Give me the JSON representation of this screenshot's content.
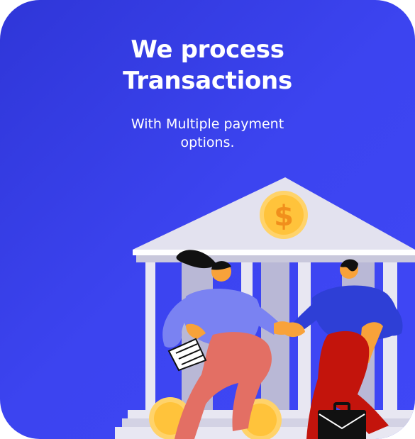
{
  "card": {
    "title_line1": "We process",
    "title_line2": "Transactions",
    "subtitle_line1": "With Multiple payment",
    "subtitle_line2": "options."
  },
  "illustration": {
    "coin_symbol": "$",
    "icons": [
      "bank-building-icon",
      "dollar-coin-icon",
      "briefcase-icon",
      "document-icon"
    ]
  },
  "colors": {
    "background": "#3a41ee",
    "building": "#e3e2ef",
    "coin": "#ffc33b",
    "woman_shirt": "#7a82f2",
    "woman_pants": "#e36f64",
    "man_shirt": "#2e3fd6",
    "man_pants": "#c3140c",
    "skin": "#f8a23a"
  }
}
